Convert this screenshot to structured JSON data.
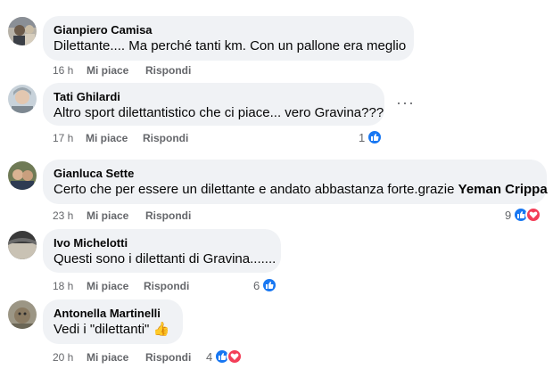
{
  "comments": [
    {
      "author": "Gianpiero Camisa",
      "text": "Dilettante.... Ma perché tanti km. Con un pallone era meglio",
      "time": "16 h",
      "like": "Mi piace",
      "reply": "Rispondi",
      "reactions": null
    },
    {
      "author": "Tati Ghilardi",
      "text": "Altro sport dilettantistico che ci piace... vero Gravina???",
      "time": "17 h",
      "like": "Mi piace",
      "reply": "Rispondi",
      "reactions": "1",
      "more": "···"
    },
    {
      "author": "Gianluca Sette",
      "text": "Certo che per essere un dilettante e andato abbastanza forte.grazie ",
      "mention": "Yeman Crippa",
      "time": "23 h",
      "like": "Mi piace",
      "reply": "Rispondi",
      "reactions": "9"
    },
    {
      "author": "Ivo Michelotti",
      "text": "Questi sono i dilettanti di Gravina.......",
      "time": "18 h",
      "like": "Mi piace",
      "reply": "Rispondi",
      "reactions": "6"
    },
    {
      "author": "Antonella Martinelli",
      "text": "Vedi i \"dilettanti\"",
      "emoji": "👍",
      "time": "20 h",
      "like": "Mi piace",
      "reply": "Rispondi",
      "reactions": "4"
    }
  ],
  "icons": {
    "like": "thumbs-up-icon",
    "heart": "heart-icon",
    "more": "more-options-icon"
  },
  "colors": {
    "bubble": "#f0f2f5",
    "like_blue": "#1877f2",
    "heart_red": "#f33e58",
    "secondary_text": "#65676b"
  }
}
